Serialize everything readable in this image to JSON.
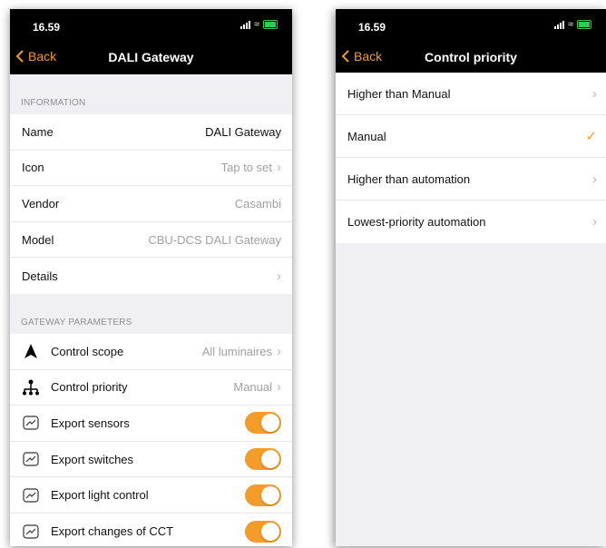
{
  "status_bar": {
    "time": "16.59"
  },
  "colors": {
    "accent": "#f39c2a",
    "navbar": "#000000",
    "background": "#efeff4"
  },
  "left_screen": {
    "back_label": "Back",
    "title": "DALI Gateway",
    "information_header": "INFORMATION",
    "info_rows": [
      {
        "label": "Name",
        "value": "DALI Gateway"
      },
      {
        "label": "Icon",
        "value": "Tap to set"
      },
      {
        "label": "Vendor",
        "value": "Casambi"
      },
      {
        "label": "Model",
        "value": "CBU-DCS DALI Gateway"
      },
      {
        "label": "Details",
        "value": ""
      }
    ],
    "parameters_header": "GATEWAY PARAMETERS",
    "param_rows": [
      {
        "label": "Control scope",
        "value": "All luminaires",
        "icon": "navigation-arrow-icon"
      },
      {
        "label": "Control priority",
        "value": "Manual",
        "icon": "hierarchy-icon"
      },
      {
        "label": "Export sensors",
        "toggle": true,
        "icon": "chart-line-icon"
      },
      {
        "label": "Export switches",
        "toggle": true,
        "icon": "chart-line-icon"
      },
      {
        "label": "Export light control",
        "toggle": true,
        "icon": "chart-line-icon"
      },
      {
        "label": "Export changes of CCT",
        "toggle": true,
        "icon": "chart-line-icon"
      }
    ]
  },
  "right_screen": {
    "back_label": "Back",
    "title": "Control priority",
    "options": [
      {
        "label": "Higher than Manual",
        "selected": false
      },
      {
        "label": "Manual",
        "selected": true
      },
      {
        "label": "Higher than automation",
        "selected": false
      },
      {
        "label": "Lowest-priority automation",
        "selected": false
      }
    ]
  }
}
